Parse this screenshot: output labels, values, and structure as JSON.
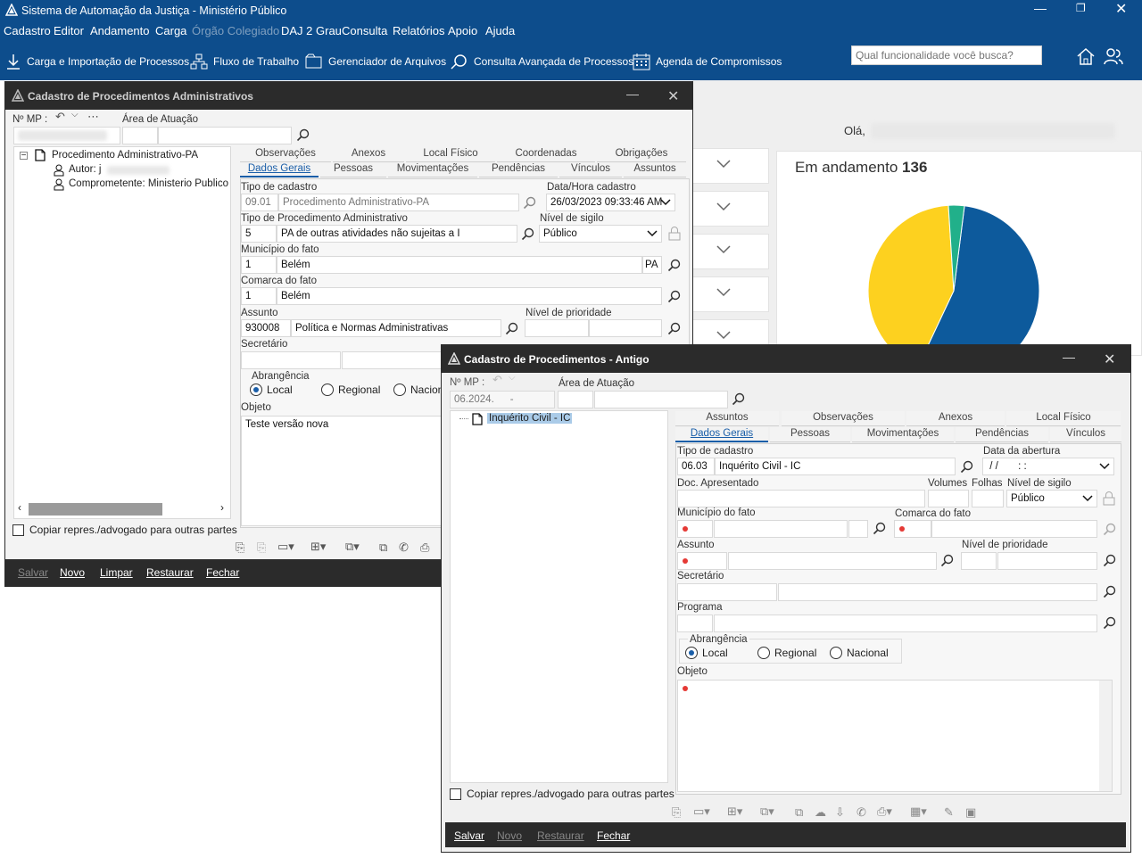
{
  "app": {
    "title": "Sistema de Automação da Justiça - Ministério Público"
  },
  "menu": [
    "Cadastro",
    "Editor",
    "Andamento",
    "Carga",
    "Órgão Colegiado",
    "DAJ 2 Grau",
    "Consulta",
    "Relatórios",
    "Apoio",
    "Ajuda"
  ],
  "toolbar": {
    "items": [
      "Carga e Importação de Processos",
      "Fluxo de Trabalho",
      "Gerenciador de Arquivos",
      "Consulta Avançada de Processos",
      "Agenda de Compromissos"
    ],
    "search_placeholder": "Qual funcionalidade você busca?"
  },
  "dashboard": {
    "greeting": "Olá,",
    "card_title": "Em andamento",
    "card_count": "136",
    "chart_data": {
      "type": "pie",
      "slices": [
        {
          "label": "",
          "value": 55,
          "color": "#0d5a9c"
        },
        {
          "label": "",
          "value": 42,
          "color": "#fdd11f"
        },
        {
          "label": "",
          "value": 3,
          "color": "#21b08a"
        }
      ]
    }
  },
  "win1": {
    "title": "Cadastro de Procedimentos Administrativos",
    "nmp_label": "Nº MP :",
    "area_label": "Área de Atuação",
    "tree": [
      "Procedimento Administrativo-PA",
      "Autor: j",
      "Comprometente: Ministerio Publico"
    ],
    "tabs_top": [
      "Observações",
      "Anexos",
      "Local Físico",
      "Coordenadas",
      "Obrigações"
    ],
    "tabs_bottom": [
      "Dados Gerais",
      "Pessoas",
      "Movimentações",
      "Pendências",
      "Vínculos",
      "Assuntos"
    ],
    "tipo_cadastro_label": "Tipo de cadastro",
    "tipo_cadastro_code": "09.01",
    "tipo_cadastro_value": "Procedimento Administrativo-PA",
    "data_hora_label": "Data/Hora cadastro",
    "data_hora_value": "26/03/2023 09:33:46 AM",
    "tipo_proc_label": "Tipo de Procedimento Administrativo",
    "tipo_proc_code": "5",
    "tipo_proc_value": "PA de outras atividades não sujeitas a I",
    "sigilo_label": "Nível de sigilo",
    "sigilo_value": "Público",
    "municipio_label": "Município do fato",
    "municipio_code": "1",
    "municipio_value": "Belém",
    "municipio_uf": "PA",
    "comarca_label": "Comarca do fato",
    "comarca_code": "1",
    "comarca_value": "Belém",
    "assunto_label": "Assunto",
    "assunto_code": "930008",
    "assunto_value": "Política e Normas Administrativas",
    "prioridade_label": "Nível de prioridade",
    "secretario_label": "Secretário",
    "abrangencia_label": "Abrangência",
    "radios": [
      "Local",
      "Regional",
      "Nacion"
    ],
    "objeto_label": "Objeto",
    "objeto_value": "Teste versão nova",
    "copiar_label": "Copiar repres./advogado para outras partes",
    "footer": [
      "Salvar",
      "Novo",
      "Limpar",
      "Restaurar",
      "Fechar"
    ]
  },
  "win2": {
    "title": "Cadastro de Procedimentos - Antigo",
    "nmp_label": "Nº MP :",
    "nmp_value": "06.2024.",
    "nmp_dash": "-",
    "area_label": "Área de Atuação",
    "tree": [
      "Inquérito Civil - IC"
    ],
    "tabs_top": [
      "Assuntos",
      "Observações",
      "Anexos",
      "Local Físico"
    ],
    "tabs_bottom": [
      "Dados Gerais",
      "Pessoas",
      "Movimentações",
      "Pendências",
      "Vínculos"
    ],
    "tipo_cadastro_label": "Tipo de cadastro",
    "tipo_cadastro_code": "06.03",
    "tipo_cadastro_value": "Inquérito Civil - IC",
    "data_abertura_label": "Data da abertura",
    "data_abertura_value": " / /       : :",
    "doc_label": "Doc. Apresentado",
    "volumes_label": "Volumes",
    "folhas_label": "Folhas",
    "sigilo_label": "Nível de sigilo",
    "sigilo_value": "Público",
    "municipio_label": "Município do fato",
    "comarca_label": "Comarca do fato",
    "assunto_label": "Assunto",
    "prioridade_label": "Nível de prioridade",
    "secretario_label": "Secretário",
    "programa_label": "Programa",
    "abrangencia_label": "Abrangência",
    "radios": [
      "Local",
      "Regional",
      "Nacional"
    ],
    "objeto_label": "Objeto",
    "copiar_label": "Copiar repres./advogado para outras partes",
    "footer": [
      "Salvar",
      "Novo",
      "Restaurar",
      "Fechar"
    ]
  }
}
